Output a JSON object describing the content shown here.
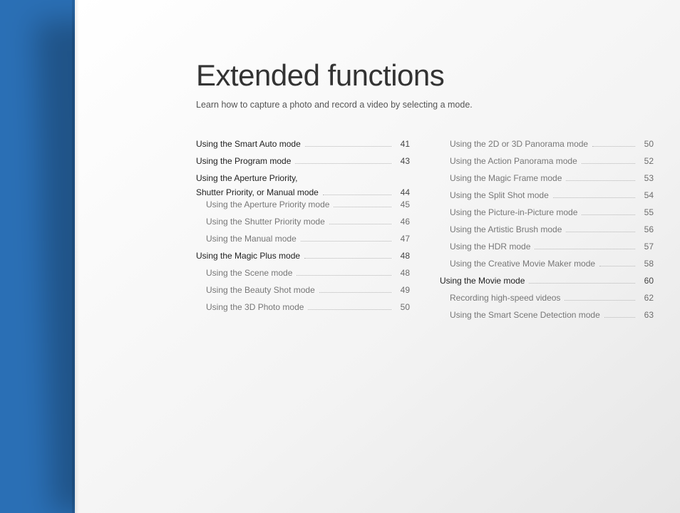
{
  "title": "Extended functions",
  "subtitle": "Learn how to capture a photo and record a video by selecting a mode.",
  "toc": {
    "col1": [
      {
        "type": "major",
        "label": "Using the Smart Auto mode",
        "page": "41"
      },
      {
        "type": "major",
        "label": "Using the Program mode",
        "page": "43"
      },
      {
        "type": "major-multiline",
        "labelA": "Using the Aperture Priority,",
        "labelB": "Shutter Priority, or Manual mode",
        "page": "44"
      },
      {
        "type": "minor",
        "label": "Using the Aperture Priority mode",
        "page": "45"
      },
      {
        "type": "minor",
        "label": "Using the Shutter Priority mode",
        "page": "46"
      },
      {
        "type": "minor",
        "label": "Using the Manual mode",
        "page": "47"
      },
      {
        "type": "major",
        "label": "Using the Magic Plus mode",
        "page": "48"
      },
      {
        "type": "minor",
        "label": "Using the Scene mode",
        "page": "48"
      },
      {
        "type": "minor",
        "label": "Using the Beauty Shot mode",
        "page": "49"
      },
      {
        "type": "minor",
        "label": "Using the 3D Photo mode",
        "page": "50"
      }
    ],
    "col2": [
      {
        "type": "minor",
        "label": "Using the 2D or 3D Panorama mode",
        "page": "50"
      },
      {
        "type": "minor",
        "label": "Using the Action Panorama mode",
        "page": "52"
      },
      {
        "type": "minor",
        "label": "Using the Magic Frame mode",
        "page": "53"
      },
      {
        "type": "minor",
        "label": "Using the Split Shot mode",
        "page": "54"
      },
      {
        "type": "minor",
        "label": "Using the Picture-in-Picture mode",
        "page": "55"
      },
      {
        "type": "minor",
        "label": "Using the Artistic Brush mode",
        "page": "56"
      },
      {
        "type": "minor",
        "label": "Using the HDR mode",
        "page": "57"
      },
      {
        "type": "minor",
        "label": "Using the Creative Movie Maker mode",
        "page": "58"
      },
      {
        "type": "major",
        "label": "Using the Movie mode",
        "page": "60"
      },
      {
        "type": "minor",
        "label": "Recording high-speed videos",
        "page": "62"
      },
      {
        "type": "minor",
        "label": "Using the Smart Scene Detection mode",
        "page": "63"
      }
    ]
  }
}
